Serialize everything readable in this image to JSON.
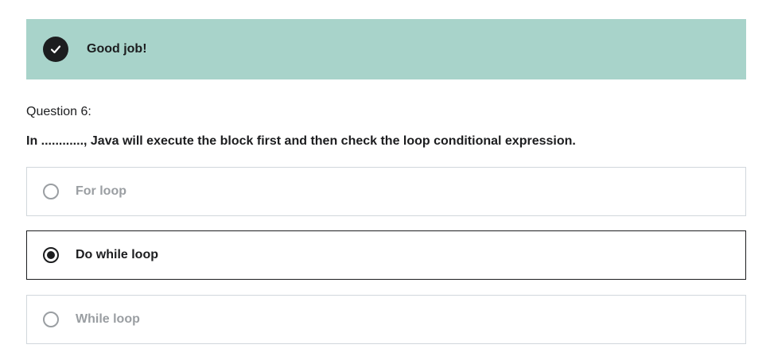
{
  "feedback": {
    "icon": "check-circle-icon",
    "message": "Good job!",
    "background": "#a8d3ca"
  },
  "question": {
    "label": "Question 6:",
    "text": "In ............, Java will execute the block first and then check the loop conditional expression."
  },
  "options": [
    {
      "label": "For loop",
      "selected": false
    },
    {
      "label": "Do while loop",
      "selected": true
    },
    {
      "label": "While loop",
      "selected": false
    }
  ]
}
